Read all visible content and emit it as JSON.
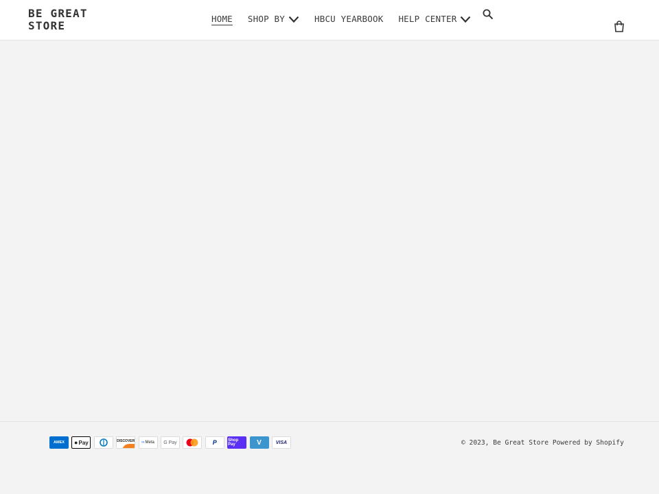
{
  "header": {
    "logo": "BE GREAT STORE",
    "nav": [
      {
        "label": "HOME",
        "active": true,
        "dropdown": false
      },
      {
        "label": "SHOP BY",
        "active": false,
        "dropdown": true
      },
      {
        "label": "HBCU YEARBOOK",
        "active": false,
        "dropdown": false
      },
      {
        "label": "HELP CENTER",
        "active": false,
        "dropdown": true
      }
    ],
    "icons": {
      "search": "search-icon",
      "cart": "cart-icon",
      "dropdown": "chevron-down-icon"
    }
  },
  "footer": {
    "payment_methods": [
      {
        "name": "American Express",
        "label": "AMEX",
        "color": "#016fd0"
      },
      {
        "name": "Apple Pay",
        "label": "Pay",
        "color": "#000000"
      },
      {
        "name": "Diners Club",
        "label": "D",
        "color": "#0079be"
      },
      {
        "name": "Discover",
        "label": "DISCOVER",
        "color": "#f48120"
      },
      {
        "name": "Meta Pay",
        "label": "Meta",
        "color": "#1c1e21"
      },
      {
        "name": "Google Pay",
        "label": "G Pay",
        "color": "#5f6368"
      },
      {
        "name": "Mastercard",
        "label": "",
        "color": "#eb001b"
      },
      {
        "name": "PayPal",
        "label": "P",
        "color": "#003087"
      },
      {
        "name": "Shop Pay",
        "label": "Shop Pay",
        "color": "#5a31f4"
      },
      {
        "name": "Venmo",
        "label": "V",
        "color": "#3d95ce"
      },
      {
        "name": "Visa",
        "label": "VISA",
        "color": "#1a1f71"
      }
    ],
    "copyright_prefix": "© 2023,",
    "store_link": "Be Great Store",
    "powered_by": "Powered by Shopify"
  },
  "colors": {
    "background": "#f3f3f3",
    "header_bg": "#ffffff",
    "text": "#3a3a3a"
  }
}
